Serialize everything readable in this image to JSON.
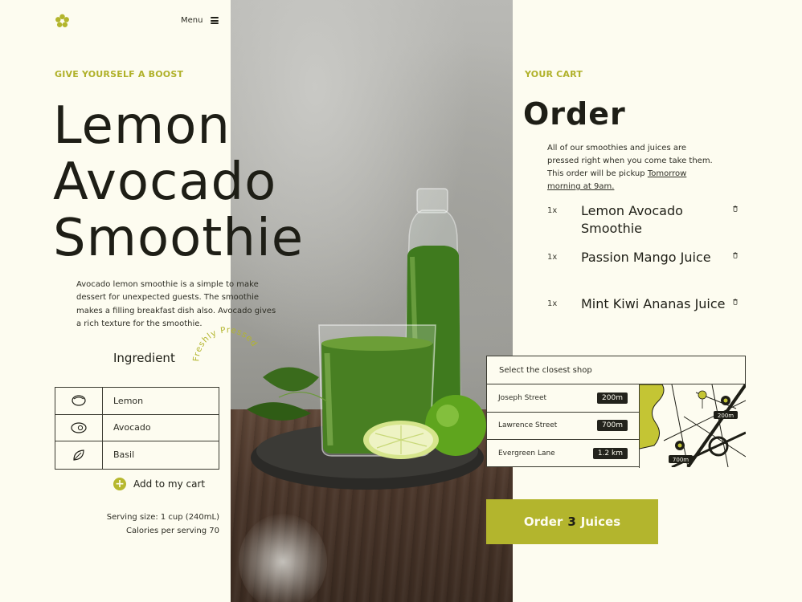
{
  "header": {
    "menu_label": "Menu",
    "logo_icon": "flower-logo-icon",
    "menu_icon": "hamburger-icon"
  },
  "product": {
    "eyebrow": "GIVE YOURSELF A BOOST",
    "title_lines": [
      "Lemon",
      "Avocado",
      "Smoothie"
    ],
    "description": "Avocado lemon smoothie is a simple to make dessert for unexpected guests. The smoothie makes a filling breakfast dish also. Avocado gives a rich texture for the smoothie.",
    "badge_text": "Freshly Pressed",
    "ingredient_heading": "Ingredient",
    "ingredients": [
      {
        "name": "Lemon",
        "icon": "lemon-icon"
      },
      {
        "name": "Avocado",
        "icon": "avocado-icon"
      },
      {
        "name": "Basil",
        "icon": "basil-leaf-icon"
      }
    ],
    "add_to_cart": "Add to my cart",
    "serving_size": "Serving size: 1 cup (240mL)",
    "calories": "Calories per serving 70"
  },
  "cart": {
    "eyebrow": "YOUR CART",
    "title": "Order",
    "description_prefix": "All of our smoothies and juices are pressed right when you come take them. This order will be pickup ",
    "pickup_time": "Tomorrow morning at 9am.",
    "items": [
      {
        "qty": "1x",
        "name": "Lemon Avocado Smoothie"
      },
      {
        "qty": "1x",
        "name": "Passion Mango Juice"
      },
      {
        "qty": "1x",
        "name": "Mint Kiwi Ananas Juice"
      }
    ],
    "delete_icon": "trash-icon"
  },
  "shops": {
    "heading": "Select the closest shop",
    "list": [
      {
        "name": "Joseph Street",
        "distance": "200m"
      },
      {
        "name": "Lawrence Street",
        "distance": "700m"
      },
      {
        "name": "Evergreen Lane",
        "distance": "1.2 km"
      }
    ],
    "map_labels": [
      "200m",
      "700m"
    ]
  },
  "order_button": {
    "prefix": "Order",
    "count": "3",
    "suffix": "Juices"
  },
  "colors": {
    "background": "#fdfcf0",
    "accent": "#b3b52d",
    "text": "#1e1e16"
  }
}
